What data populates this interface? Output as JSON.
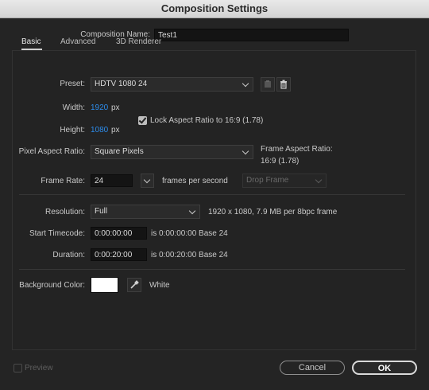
{
  "window": {
    "title": "Composition Settings"
  },
  "composition_name": {
    "label": "Composition Name:",
    "value": "Test1"
  },
  "tabs": [
    {
      "label": "Basic",
      "active": true
    },
    {
      "label": "Advanced",
      "active": false
    },
    {
      "label": "3D Renderer",
      "active": false
    }
  ],
  "preset": {
    "label": "Preset:",
    "value": "HDTV 1080 24"
  },
  "width": {
    "label": "Width:",
    "value": "1920",
    "unit": "px"
  },
  "height": {
    "label": "Height:",
    "value": "1080",
    "unit": "px"
  },
  "lock_aspect": {
    "label": "Lock Aspect Ratio to 16:9 (1.78)",
    "checked": true
  },
  "pixel_aspect": {
    "label": "Pixel Aspect Ratio:",
    "value": "Square Pixels"
  },
  "frame_aspect": {
    "label": "Frame Aspect Ratio:",
    "value": "16:9 (1.78)"
  },
  "frame_rate": {
    "label": "Frame Rate:",
    "value": "24",
    "unit_label": "frames per second",
    "drop_frame": "Drop Frame"
  },
  "resolution": {
    "label": "Resolution:",
    "value": "Full",
    "info": "1920 x 1080, 7.9 MB per 8bpc frame"
  },
  "start_timecode": {
    "label": "Start Timecode:",
    "value": "0:00:00:00",
    "info": "is 0:00:00:00  Base 24"
  },
  "duration": {
    "label": "Duration:",
    "value": "0:00:20:00",
    "info": "is 0:00:20:00  Base 24"
  },
  "background_color": {
    "label": "Background Color:",
    "name": "White",
    "swatch": "#ffffff"
  },
  "footer": {
    "preview_label": "Preview",
    "cancel_label": "Cancel",
    "ok_label": "OK"
  },
  "colors": {
    "accent_value": "#2d8ceb",
    "background": "#242424"
  }
}
